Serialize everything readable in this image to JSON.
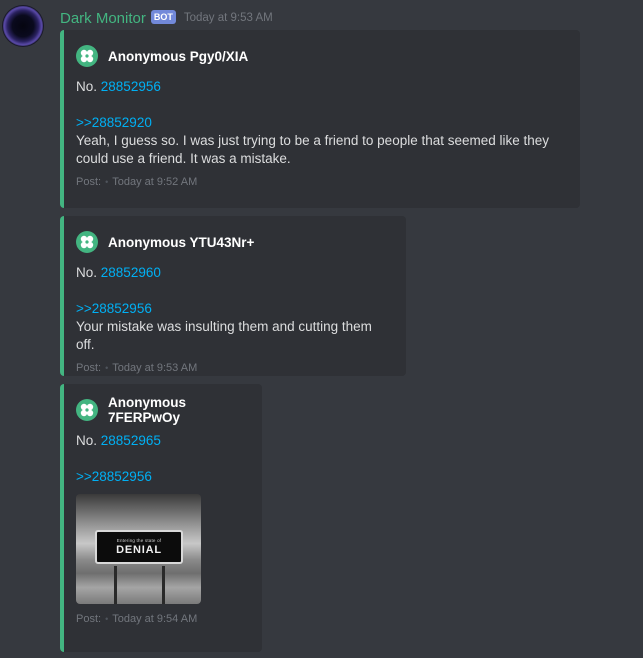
{
  "message": {
    "username": "Dark Monitor",
    "bot_tag": "BOT",
    "timestamp": "Today at 9:53 AM"
  },
  "embeds": [
    {
      "author": "Anonymous Pgy0/XIA",
      "no_label": "No.",
      "post_number": "28852956",
      "reply_link": ">>28852920",
      "text_lines": [
        "Yeah, I guess so. I was just trying to be a friend to people that seemed like they",
        "could use a friend. It was a mistake."
      ],
      "footer_label": "Post:",
      "footer_sep": "•",
      "footer_time": "Today at 9:52 AM"
    },
    {
      "author": "Anonymous YTU43Nr+",
      "no_label": "No.",
      "post_number": "28852960",
      "reply_link": ">>28852956",
      "text_lines": [
        "Your mistake was insulting them and cutting them off."
      ],
      "footer_label": "Post:",
      "footer_sep": "•",
      "footer_time": "Today at 9:53 AM"
    },
    {
      "author": "Anonymous 7FERPwOy",
      "no_label": "No.",
      "post_number": "28852965",
      "reply_link": ">>28852956",
      "image": {
        "sign_small_text": "Entering the state of",
        "sign_big_text": "DENIAL"
      },
      "footer_label": "Post:",
      "footer_sep": "•",
      "footer_time": "Today at 9:54 AM"
    }
  ],
  "colors": {
    "background": "#36393f",
    "embed_bg": "#2f3136",
    "embed_border": "#43b581",
    "username": "#43b581",
    "bot_tag": "#7289da",
    "link": "#00b0f4"
  },
  "icons": {
    "author_icon": "four-leaf-clover-icon"
  }
}
